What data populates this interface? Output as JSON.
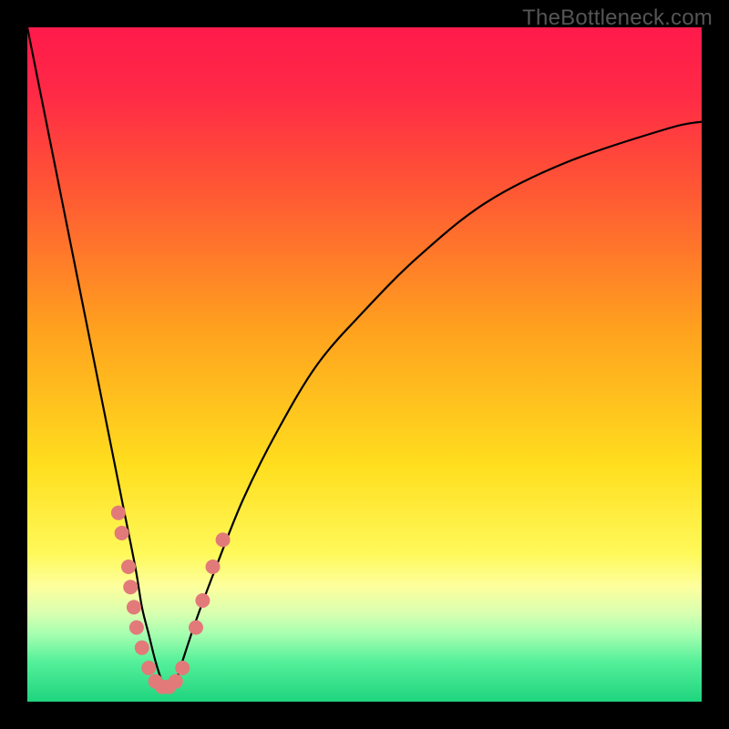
{
  "watermark": {
    "text": "TheBottleneck.com"
  },
  "chart_data": {
    "type": "line",
    "title": "",
    "xlabel": "",
    "ylabel": "",
    "xlim": [
      0,
      100
    ],
    "ylim": [
      0,
      100
    ],
    "gradient_stops": [
      {
        "offset": 0.0,
        "color": "#ff1a4b"
      },
      {
        "offset": 0.1,
        "color": "#ff2a46"
      },
      {
        "offset": 0.25,
        "color": "#ff5a33"
      },
      {
        "offset": 0.45,
        "color": "#ffa21e"
      },
      {
        "offset": 0.65,
        "color": "#ffde1e"
      },
      {
        "offset": 0.78,
        "color": "#fff95a"
      },
      {
        "offset": 0.83,
        "color": "#fdff9e"
      },
      {
        "offset": 0.87,
        "color": "#d7ffb0"
      },
      {
        "offset": 0.9,
        "color": "#a6ffb0"
      },
      {
        "offset": 0.94,
        "color": "#56f09a"
      },
      {
        "offset": 1.0,
        "color": "#1fd47e"
      }
    ],
    "series": [
      {
        "name": "bottleneck-curve",
        "x": [
          0,
          2,
          4,
          6,
          8,
          10,
          12,
          14,
          16,
          17,
          18,
          19,
          20,
          21,
          22,
          23,
          25,
          28,
          32,
          37,
          43,
          50,
          58,
          68,
          80,
          95,
          100
        ],
        "y": [
          100,
          90,
          80,
          70,
          60,
          50,
          40,
          30,
          20,
          14,
          10,
          6,
          3,
          2,
          3,
          6,
          12,
          20,
          30,
          40,
          50,
          58,
          66,
          74,
          80,
          85,
          86
        ]
      }
    ],
    "marker_points": {
      "name": "highlighted-points",
      "color": "#e27a7a",
      "radius": 8,
      "points": [
        {
          "x": 13.5,
          "y": 28
        },
        {
          "x": 14.0,
          "y": 25
        },
        {
          "x": 15.0,
          "y": 20
        },
        {
          "x": 15.3,
          "y": 17
        },
        {
          "x": 15.8,
          "y": 14
        },
        {
          "x": 16.2,
          "y": 11
        },
        {
          "x": 17.0,
          "y": 8
        },
        {
          "x": 18.0,
          "y": 5
        },
        {
          "x": 19.0,
          "y": 3
        },
        {
          "x": 20.0,
          "y": 2.2
        },
        {
          "x": 21.0,
          "y": 2.2
        },
        {
          "x": 22.0,
          "y": 3
        },
        {
          "x": 23.0,
          "y": 5
        },
        {
          "x": 25.0,
          "y": 11
        },
        {
          "x": 26.0,
          "y": 15
        },
        {
          "x": 27.5,
          "y": 20
        },
        {
          "x": 29.0,
          "y": 24
        }
      ]
    }
  }
}
